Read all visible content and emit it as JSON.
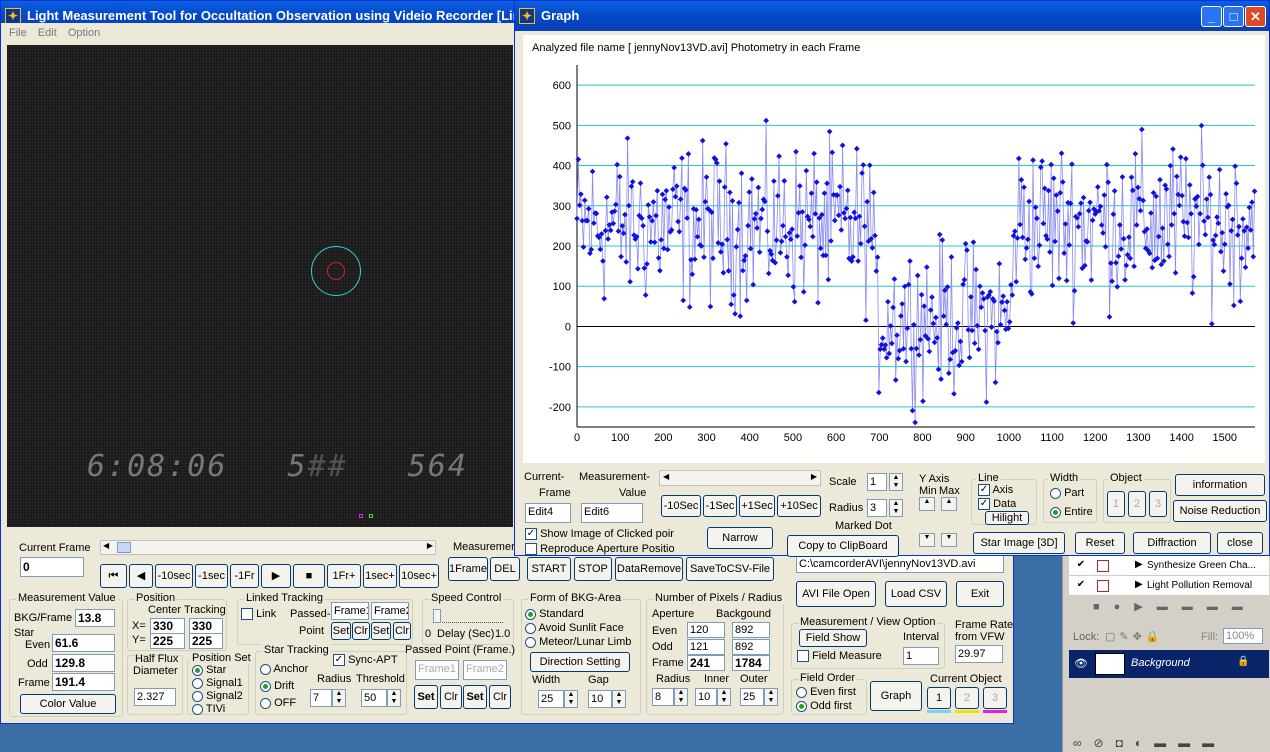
{
  "main": {
    "title": "Light Measurement Tool for Occultation Observation using Videio Recorder [Lin",
    "menu": [
      "File",
      "Edit",
      "Option"
    ],
    "video": {
      "timestamp1": "6:08:06",
      "timestamp2": "5",
      "timestamp3": "564"
    },
    "current_frame": {
      "label": "Current Frame",
      "value": "0"
    },
    "nav_buttons": [
      "⏮",
      "◀",
      "-10sec",
      "-1sec",
      "-1Fr",
      "▶",
      "■",
      "1Fr+",
      "1sec+",
      "10sec+"
    ],
    "measurement_label": "Measuremen",
    "meas_buttons": [
      "1Frame",
      "DEL"
    ],
    "ctrl_buttons": [
      "START",
      "STOP",
      "DataRemove",
      "SaveToCSV-File"
    ],
    "measurement_value": {
      "title": "Measurement Value",
      "bkg_label": "BKG/Frame",
      "bkg": "13.8",
      "star_label": "Star",
      "even_label": "Even",
      "even": "61.6",
      "odd_label": "Odd",
      "odd": "129.8",
      "frame_label": "Frame",
      "frame": "191.4",
      "button": "Color Value"
    },
    "position": {
      "title": "Position",
      "center": "Center",
      "tracking": "Tracking",
      "x_label": "X=",
      "y_label": "Y=",
      "cx": "330",
      "tx": "330",
      "cy": "225",
      "ty": "225"
    },
    "half_flux": {
      "title1": "Half Flux",
      "title2": "Diameter",
      "value": "2.327"
    },
    "position_set": {
      "title": "Position Set",
      "options": [
        "Star",
        "Signal1",
        "Signal2",
        "TIVi"
      ]
    },
    "linked_tracking": {
      "title": "Linked Tracking",
      "link": "Link",
      "passed": "Passed-",
      "point": "Point",
      "frame1": "Frame1",
      "frame2": "Frame2",
      "set": "Set",
      "clr": "Clr"
    },
    "star_tracking": {
      "title": "Star Tracking",
      "anchor": "Anchor",
      "drift": "Drift",
      "off": "OFF",
      "sync": "Sync-APT",
      "radius_label": "Radius",
      "radius": "7",
      "threshold_label": "Threshold",
      "threshold": "50"
    },
    "passed_point": {
      "title": "Passed Point (Frame.)",
      "frame1": "Frame1",
      "frame2": "Frame2",
      "set": "Set",
      "clr": "Clr"
    },
    "speed": {
      "title": "Speed Control",
      "min": "0",
      "mid": "Delay (Sec)",
      "max": "1.0"
    },
    "bkg_area": {
      "title": "Form of BKG-Area",
      "options": [
        "Standard",
        "Avoid Sunlit Face",
        "Meteor/Lunar Limb"
      ],
      "direction": "Direction Setting",
      "width_label": "Width",
      "width": "25",
      "gap_label": "Gap",
      "gap": "10"
    },
    "pixels": {
      "title": "Number of Pixels / Radius",
      "aperture": "Aperture",
      "background": "Backgound",
      "even_label": "Even",
      "even_a": "120",
      "even_b": "892",
      "odd_label": "Odd",
      "odd_a": "121",
      "odd_b": "892",
      "frame_label": "Frame",
      "frame_a": "241",
      "frame_b": "1784",
      "radius_label": "Radius",
      "radius": "8",
      "inner_label": "Inner",
      "inner": "10",
      "outer_label": "Outer",
      "outer": "25"
    },
    "file": {
      "path": "C:\\camcorderAVI\\jennyNov13VD.avi",
      "open": "AVI File Open",
      "load": "Load CSV",
      "exit": "Exit"
    },
    "view": {
      "title": "Measurement / View Option",
      "field_show": "Field Show",
      "interval_label": "Interval",
      "field_measure": "Field Measure",
      "interval": "1"
    },
    "frame_rate": {
      "label1": "Frame Rate",
      "label2": "from VFW",
      "value": "29.97"
    },
    "field_order": {
      "title": "Field Order",
      "even": "Even first",
      "odd": "Odd first"
    },
    "graph_button": "Graph",
    "current_object": {
      "title": "Current Object",
      "items": [
        "1",
        "2",
        "3"
      ]
    }
  },
  "graph": {
    "title": "Graph",
    "heading": "Analyzed file name [ jennyNov13VD.avi]   Photometry in each Frame",
    "current_frame_label": "Current-",
    "current_frame_label2": "Frame",
    "measurement_label": "Measurement-",
    "measurement_label2": "Value",
    "edit4": "Edit4",
    "edit6": "Edit6",
    "step_buttons": [
      "-10Sec",
      "-1Sec",
      "+1Sec",
      "+10Sec"
    ],
    "show_image": "Show Image of Clicked poir",
    "reproduce": "Reproduce Aperture Positio",
    "narrow": "Narrow",
    "scale_label": "Scale",
    "scale": "1",
    "radius_label": "Radius",
    "radius": "3",
    "marked_dot": "Marked Dot",
    "copy": "Copy to ClipBoard",
    "yaxis_title": "Y Axis",
    "ymin": "Min",
    "ymax": "Max",
    "line_title": "Line",
    "axis": "Axis",
    "data": "Data",
    "hilight": "Hilight",
    "width_title": "Width",
    "part": "Part",
    "entire": "Entire",
    "object_title": "Object",
    "objects": [
      "1",
      "2",
      "3"
    ],
    "information": "information",
    "noise": "Noise Reduction",
    "star_image": "Star Image [3D]",
    "reset": "Reset",
    "diffraction": "Diffraction",
    "close": "close"
  },
  "layers": {
    "items": [
      "Synthesize Green Cha...",
      "Light Pollution Removal"
    ],
    "lock": "Lock:",
    "fill": "Fill:",
    "fill_value": "100%",
    "background": "Background"
  },
  "chart_data": {
    "type": "scatter",
    "xlim": [
      0,
      1570
    ],
    "ylim": [
      -250,
      650
    ],
    "xticks": [
      0,
      100,
      200,
      300,
      400,
      500,
      600,
      700,
      800,
      900,
      1000,
      1100,
      1200,
      1300,
      1400,
      1500
    ],
    "yticks": [
      600,
      500,
      400,
      300,
      200,
      100,
      0,
      -100,
      -200
    ],
    "color": "#1010e0",
    "line_color": "#8c8cf0",
    "segments": [
      {
        "from": 0,
        "to": 690,
        "mean": 250,
        "spread": 150
      },
      {
        "from": 690,
        "to": 1010,
        "mean": 20,
        "spread": 140
      },
      {
        "from": 1010,
        "to": 1570,
        "mean": 260,
        "spread": 150
      }
    ]
  }
}
